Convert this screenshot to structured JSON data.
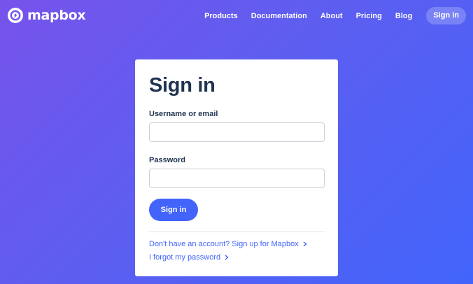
{
  "brand": {
    "name": "mapbox",
    "color": "#ffffff"
  },
  "nav": {
    "items": [
      {
        "label": "Products"
      },
      {
        "label": "Documentation"
      },
      {
        "label": "About"
      },
      {
        "label": "Pricing"
      },
      {
        "label": "Blog"
      }
    ],
    "signin_label": "Sign in"
  },
  "signin_form": {
    "title": "Sign in",
    "username_label": "Username or email",
    "username_value": "",
    "password_label": "Password",
    "password_value": "",
    "submit_label": "Sign in",
    "signup_link": "Don't have an account? Sign up for Mapbox",
    "forgot_link": "I forgot my password"
  },
  "colors": {
    "background_start": "#7753eb",
    "background_end": "#4264fb",
    "accent": "#4264fb",
    "heading": "#1f3350"
  },
  "icons": {
    "logo": "mapbox-logo-icon",
    "link_arrow": "chevron-right-icon"
  }
}
